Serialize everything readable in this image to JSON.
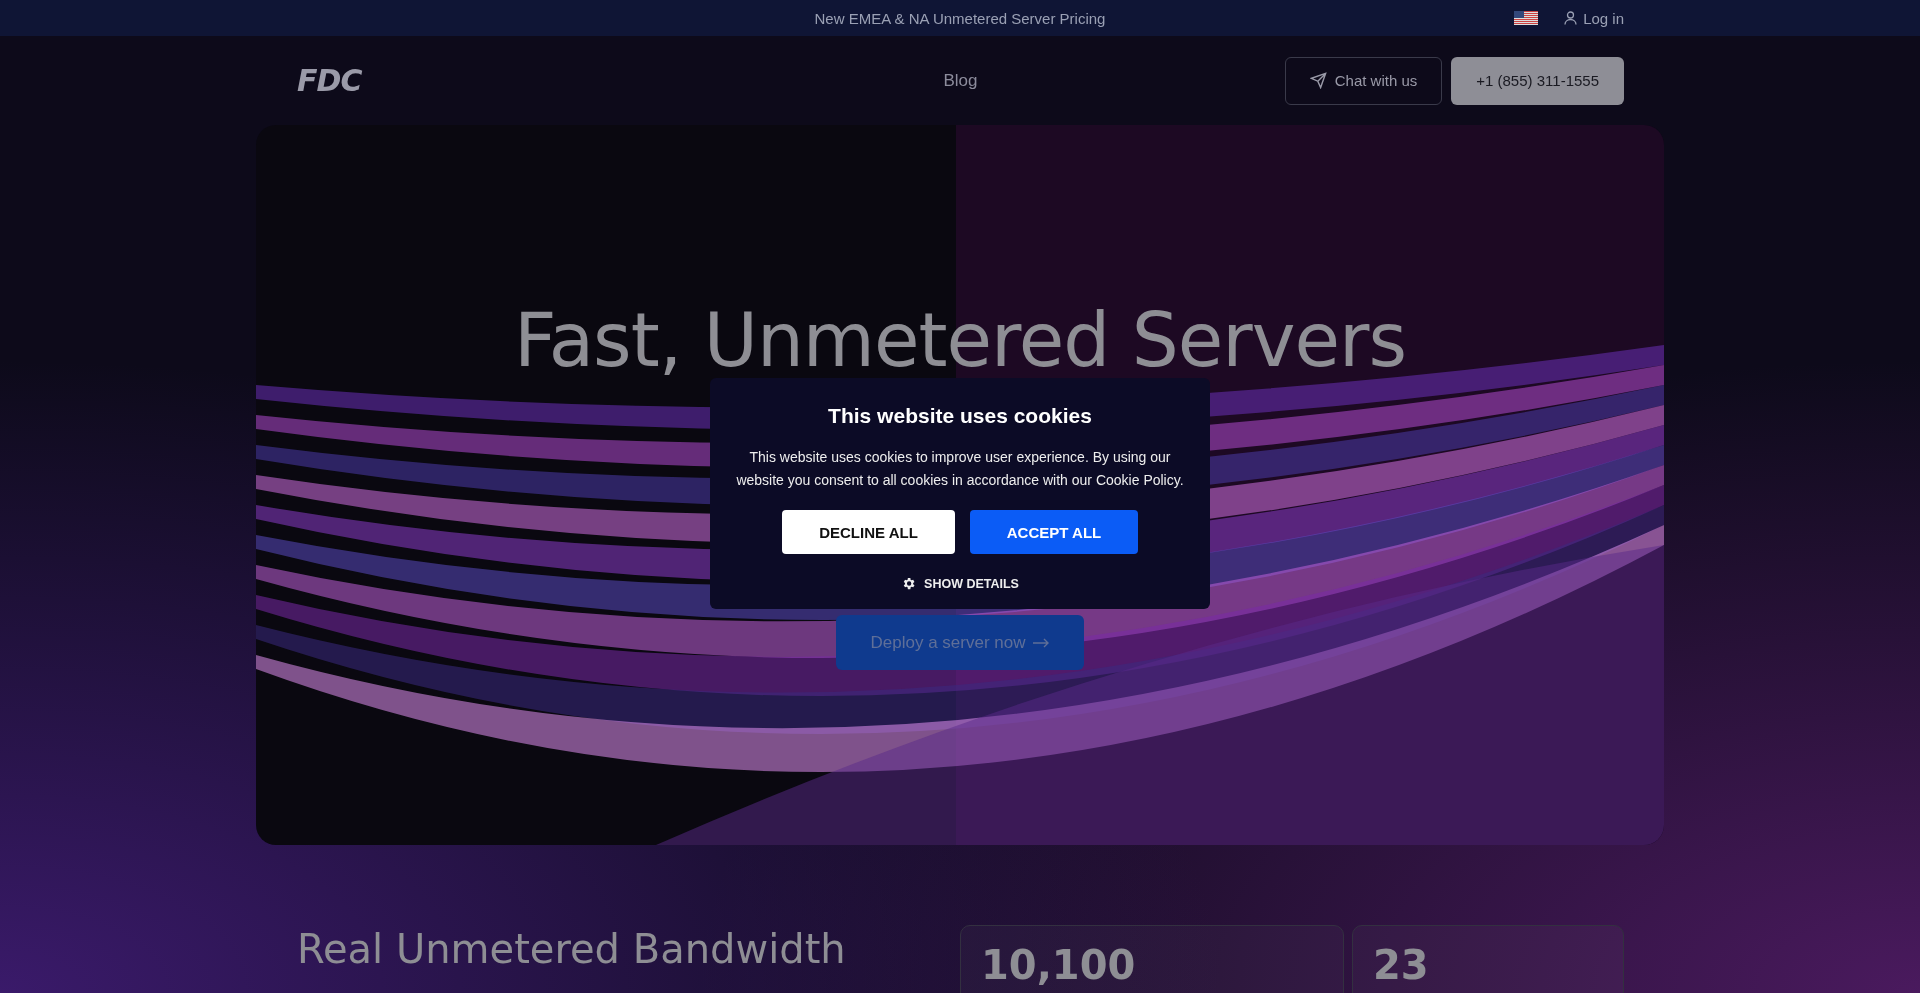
{
  "announcement": {
    "text": "New EMEA & NA Unmetered Server Pricing"
  },
  "top_links": [
    {
      "label": "Log in"
    }
  ],
  "header": {
    "logo": "FDC",
    "nav": [
      "Blog"
    ],
    "chat_button": "Chat with us",
    "phone_button": "+1 (855) 311-1555"
  },
  "hero": {
    "title": "Fast, Unmetered Servers",
    "cta": "Deploy a server now"
  },
  "cookie_dialog": {
    "title": "This website uses cookies",
    "message": "This website uses cookies to improve user experience. By using our website you consent to all cookies in accordance with our Cookie Policy.",
    "buttons": [
      {
        "label": "DECLINE ALL",
        "kind": "secondary"
      },
      {
        "label": "ACCEPT ALL",
        "kind": "primary"
      }
    ],
    "details_link": "SHOW DETAILS"
  },
  "stats_section": {
    "heading": "Real Unmetered Bandwidth",
    "stats": [
      "10,100",
      "23"
    ]
  }
}
